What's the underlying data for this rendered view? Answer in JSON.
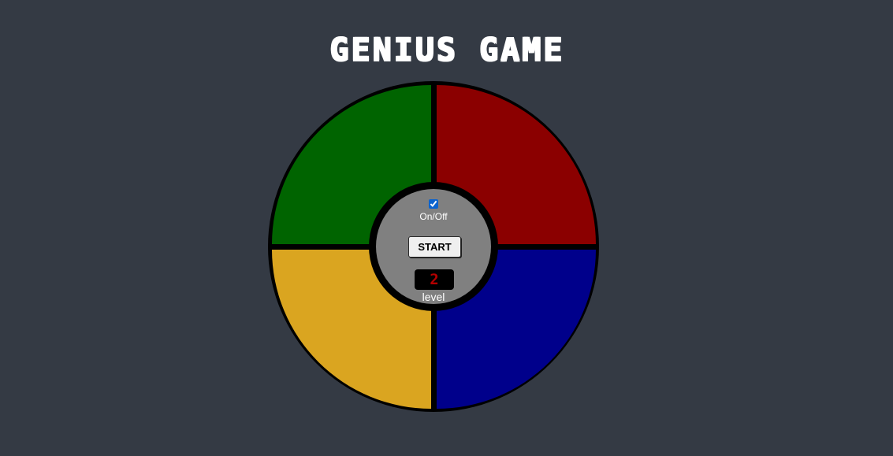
{
  "app": {
    "title": "GENIUS GAME"
  },
  "board": {
    "pads": [
      {
        "name": "green",
        "color": "#006400"
      },
      {
        "name": "red",
        "color": "#8b0000"
      },
      {
        "name": "yellow",
        "color": "#daa520"
      },
      {
        "name": "blue",
        "color": "#00008b"
      }
    ],
    "ring_color": "#000000",
    "center_color": "#808080"
  },
  "controls": {
    "power_label": "On/Off",
    "power_on": true,
    "start_label": "START",
    "level_value": "2",
    "level_label": "level",
    "level_text_color": "#b40000"
  },
  "colors": {
    "background": "#343a44",
    "title": "#ffffff"
  }
}
